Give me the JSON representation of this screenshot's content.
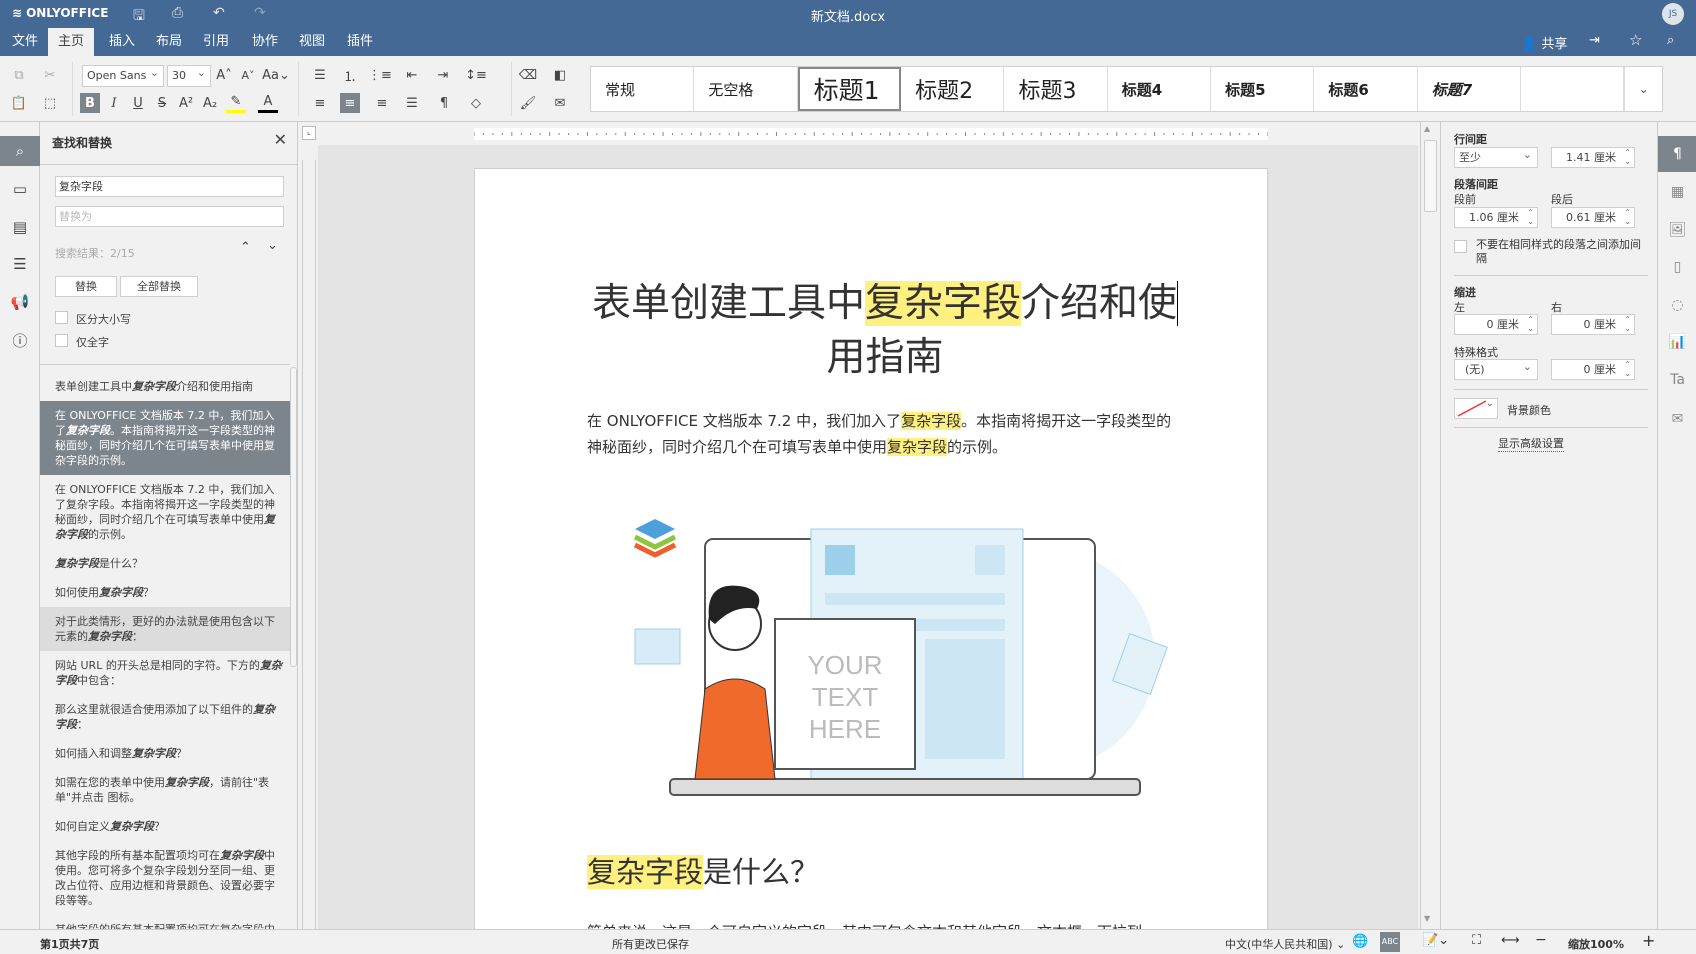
{
  "app": {
    "brand": "ONLYOFFICE",
    "doc_title": "新文档.docx",
    "user_initials": "JS",
    "share": "共享"
  },
  "menu_tabs": [
    "文件",
    "主页",
    "插入",
    "布局",
    "引用",
    "协作",
    "视图",
    "插件"
  ],
  "toolbar": {
    "font_name": "Open Sans",
    "font_size": "30",
    "styles": [
      "常规",
      "无空格",
      "标题1",
      "标题2",
      "标题3",
      "标题4",
      "标题5",
      "标题6",
      "标题7",
      ""
    ]
  },
  "find_panel": {
    "title": "查找和替换",
    "search_value": "复杂字段",
    "replace_placeholder": "替换为",
    "result_count": "搜索结果：2/15",
    "replace_btn": "替换",
    "replace_all_btn": "全部替换",
    "match_case": "区分大小写",
    "whole_words": "仅全字",
    "results": [
      {
        "pre": "表单创建工具中",
        "em": "复杂字段",
        "post": "介绍和使用指南"
      },
      {
        "pre": "在 ONLYOFFICE 文档版本 7.2 中，我们加入了",
        "em": "复杂字段",
        "post": "。本指南将揭开这一字段类型的神秘面纱，同时介绍几个在可填写表单中使用复杂字段的示例。"
      },
      {
        "pre": "在 ONLYOFFICE 文档版本 7.2 中，我们加入了复杂字段。本指南将揭开这一字段类型的神秘面纱，同时介绍几个在可填写表单中使用",
        "em": "复杂字段",
        "post": "的示例。"
      },
      {
        "pre": "",
        "em": "复杂字段",
        "post": "是什么？"
      },
      {
        "pre": "如何使用",
        "em": "复杂字段",
        "post": "？"
      },
      {
        "pre": "对于此类情形，更好的办法就是使用包含以下元素的",
        "em": "复杂字段",
        "post": "："
      },
      {
        "pre": "网站 URL 的开头总是相同的字符。下方的",
        "em": "复杂字段",
        "post": "中包含："
      },
      {
        "pre": "那么这里就很适合使用添加了以下组件的",
        "em": "复杂字段",
        "post": "："
      },
      {
        "pre": "如何插入和调整",
        "em": "复杂字段",
        "post": "？"
      },
      {
        "pre": "如需在您的表单中使用",
        "em": "复杂字段",
        "post": "，请前往\"表单\"并点击  图标。"
      },
      {
        "pre": "如何自定义",
        "em": "复杂字段",
        "post": "？"
      },
      {
        "pre": "其他字段的所有基本配置项均可在",
        "em": "复杂字段",
        "post": "中使用。您可将多个复杂字段划分至同一组、更改占位符、应用边框和背景颜色、设置必要字段等等。"
      },
      {
        "pre": "其他字段的所有基本配置项均可在复杂字段中使用。您可将多个",
        "em": "复杂字段",
        "post": "划分至同一组、更改占位符、应用边框和背景颜色、设置必要字段等等。"
      }
    ]
  },
  "document": {
    "title_a": "表单创建工具中",
    "title_hl": "复杂字段",
    "title_b": "介绍和使",
    "title_c": "用指南",
    "p1_a": "在 ONLYOFFICE 文档版本 7.2 中，我们加入了",
    "p1_hl": "复杂字段",
    "p1_b": "。本指南将揭开这一字段类型的",
    "p1_c": "神秘面纱，同时介绍几个在可填写表单中使用",
    "p1_hl2": "复杂字段",
    "p1_d": "的示例。",
    "illus_text": [
      "YOUR",
      "TEXT",
      "HERE"
    ],
    "h2_hl": "复杂字段",
    "h2_rest": "是什么？",
    "p2": "简单来说，这是一个可自定义的字段，其中可包含文本和其他字段、文本框、下拉列"
  },
  "para_settings": {
    "line_spacing_label": "行间距",
    "line_spacing_type": "至少",
    "line_spacing_value": "1.41 厘米",
    "para_spacing_label": "段落间距",
    "before_label": "段前",
    "before_value": "1.06 厘米",
    "after_label": "段后",
    "after_value": "0.61 厘米",
    "no_space_label": "不要在相同样式的段落之间添加间隔",
    "indent_label": "缩进",
    "left_label": "左",
    "left_value": "0 厘米",
    "right_label": "右",
    "right_value": "0 厘米",
    "special_label": "特殊格式",
    "special_type": "(无)",
    "special_value": "0 厘米",
    "bg_color_label": "背景颜色",
    "advanced_link": "显示高级设置"
  },
  "status": {
    "page": "第1页共7页",
    "saved": "所有更改已保存",
    "language": "中文(中华人民共和国)",
    "zoom": "缩放100%"
  },
  "colors": {
    "header": "#446995",
    "highlight": "#fff07f",
    "active": "#7d858c"
  }
}
